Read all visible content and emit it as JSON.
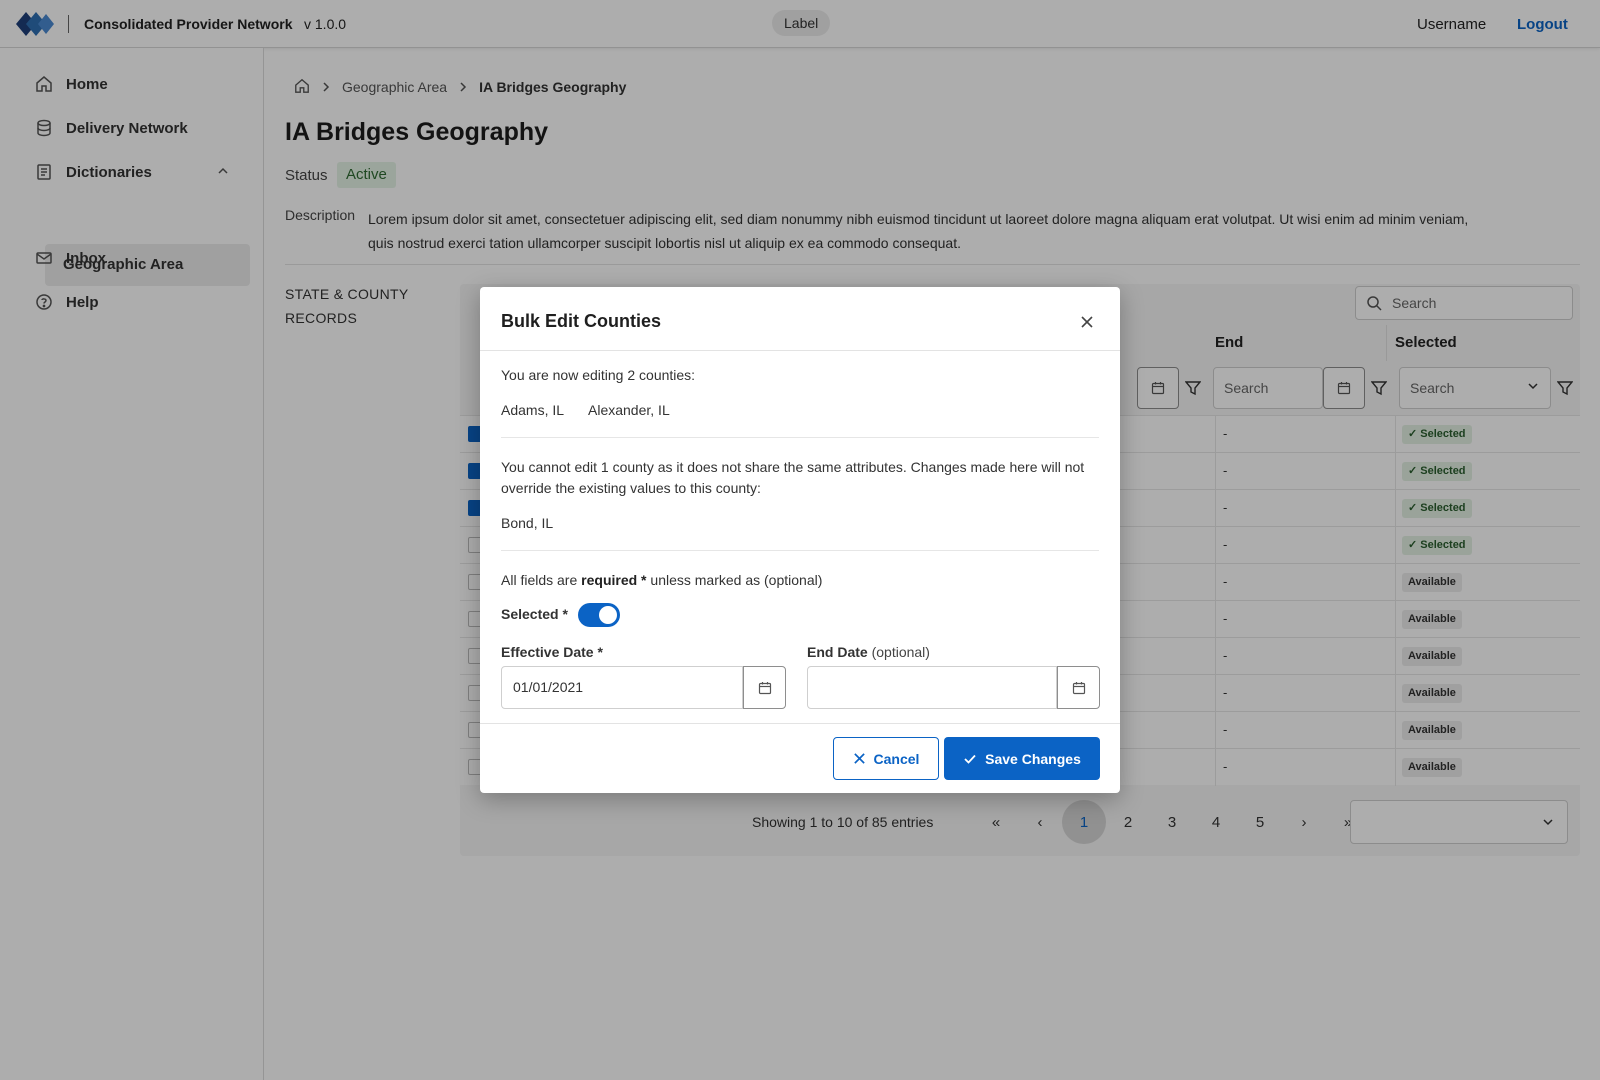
{
  "header": {
    "app_title": "Consolidated Provider Network",
    "version": "v 1.0.0",
    "label": "Label",
    "username": "Username",
    "logout": "Logout"
  },
  "sidebar": {
    "items": [
      {
        "label": "Home",
        "icon": "home-icon"
      },
      {
        "label": "Delivery Network",
        "icon": "database-icon"
      },
      {
        "label": "Dictionaries",
        "icon": "document-icon"
      },
      {
        "label": "Inbox",
        "icon": "mail-icon"
      },
      {
        "label": "Help",
        "icon": "help-icon"
      }
    ],
    "sub_item": "Geographic Area"
  },
  "breadcrumb": {
    "parent": "Geographic Area",
    "current": "IA Bridges Geography"
  },
  "page": {
    "title": "IA Bridges Geography",
    "status_label": "Status",
    "status_value": "Active",
    "description_label": "Description",
    "description": "Lorem ipsum dolor sit amet, consectetuer adipiscing elit, sed diam nonummy nibh euismod tincidunt ut laoreet dolore magna aliquam erat volutpat. Ut wisi enim ad minim veniam, quis nostrud exerci tation ullamcorper suscipit lobortis nisl ut aliquip ex ea commodo consequat.",
    "records_label": "STATE & COUNTY RECORDS"
  },
  "table": {
    "search_placeholder": "Search",
    "columns": {
      "end": "End",
      "selected": "Selected"
    },
    "filters": {
      "end_search": "Search",
      "selected_search": "Search"
    },
    "rows": [
      {
        "checked": true,
        "end": "-",
        "selected": "Selected"
      },
      {
        "checked": true,
        "end": "-",
        "selected": "Selected"
      },
      {
        "checked": true,
        "end": "-",
        "selected": "Selected"
      },
      {
        "checked": false,
        "end": "-",
        "selected": "Selected"
      },
      {
        "checked": false,
        "end": "-",
        "selected": "Available"
      },
      {
        "checked": false,
        "end": "-",
        "selected": "Available"
      },
      {
        "checked": false,
        "end": "-",
        "selected": "Available"
      },
      {
        "checked": false,
        "end": "-",
        "selected": "Available"
      },
      {
        "checked": false,
        "end": "-",
        "selected": "Available"
      },
      {
        "checked": false,
        "end": "-",
        "selected": "Available"
      }
    ]
  },
  "pagination": {
    "info": "Showing 1 to 10 of 85 entries",
    "first": "«",
    "prev": "‹",
    "pages": [
      "1",
      "2",
      "3",
      "4",
      "5"
    ],
    "active_page": "1",
    "next": "›",
    "last": "»"
  },
  "modal": {
    "title": "Bulk Edit Counties",
    "editing_text": "You are now editing 2 counties:",
    "counties": [
      "Adams, IL",
      "Alexander, IL"
    ],
    "warning_text": "You cannot edit 1 county as it does not share the same attributes. Changes made here will not override the existing values to this county:",
    "excluded_county": "Bond, IL",
    "required_prefix": "All fields are ",
    "required_bold": "required *",
    "required_suffix": " unless marked as (optional)",
    "toggle_label": "Selected *",
    "toggle_on": true,
    "effective_label": "Effective Date *",
    "effective_value": "01/01/2021",
    "end_label": "End Date",
    "end_optional": "(optional)",
    "end_value": "",
    "cancel": "Cancel",
    "save": "Save Changes"
  },
  "colors": {
    "primary": "#0b63c5",
    "overlay": "rgba(0,0,0,0.32)",
    "status_active_bg": "#e5f3e6",
    "selected_badge_bg": "#e3f1e3",
    "available_badge_bg": "#ececec"
  }
}
